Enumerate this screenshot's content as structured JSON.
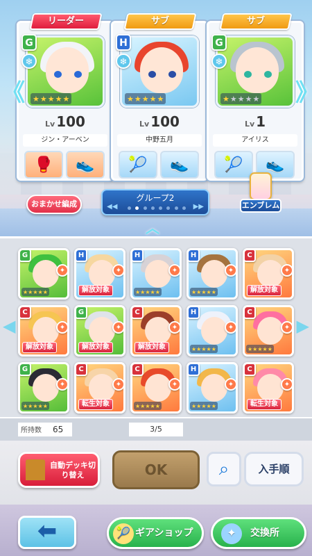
{
  "deck": {
    "slots": [
      {
        "role": "リーダー",
        "role_color": "red",
        "rarity": "G",
        "element": "❄",
        "level_prefix": "Lv",
        "level": "100",
        "name": "ジン・アーベン",
        "hair": "#f2f4f8",
        "eye": "#2a6ad8",
        "gear": [
          "🥊",
          "👟"
        ],
        "stars": 5
      },
      {
        "role": "サブ",
        "role_color": "gold",
        "rarity": "H",
        "element": "❄",
        "level_prefix": "Lv",
        "level": "100",
        "name": "中野五月",
        "hair": "#e8452e",
        "eye": "#2a4ea6",
        "gear": [
          "🎾",
          "👟"
        ],
        "stars": 5
      },
      {
        "role": "サブ",
        "role_color": "gold",
        "rarity": "G",
        "element": "❄",
        "level_prefix": "Lv",
        "level": "1",
        "name": "アイリス",
        "hair": "#b9c4cf",
        "eye": "#2fb6a0",
        "gear": [
          "🎾",
          "👟"
        ],
        "stars": 1
      }
    ]
  },
  "controls": {
    "omakase": "おまかせ編成",
    "group_name": "グループ2",
    "group_prev": "◀◀",
    "group_next": "▶▶",
    "emblem": "エンブレム"
  },
  "roster": {
    "cards": [
      {
        "rarity": "G",
        "type": "g",
        "hair": "#3fc03f",
        "overlay": ""
      },
      {
        "rarity": "H",
        "type": "h",
        "hair": "#f6d7a0",
        "overlay": "解放対象"
      },
      {
        "rarity": "H",
        "type": "h",
        "hair": "#d7d2d6",
        "overlay": ""
      },
      {
        "rarity": "H",
        "type": "h",
        "hair": "#a5733f",
        "overlay": ""
      },
      {
        "rarity": "C",
        "type": "c",
        "hair": "#f3d2a6",
        "overlay": "解放対象"
      },
      {
        "rarity": "C",
        "type": "c",
        "hair": "#f6c552",
        "overlay": "解放対象"
      },
      {
        "rarity": "G",
        "type": "g",
        "hair": "#dfe3ea",
        "overlay": "解放対象"
      },
      {
        "rarity": "C",
        "type": "c",
        "hair": "#9c3f2a",
        "overlay": "解放対象"
      },
      {
        "rarity": "H",
        "type": "h",
        "hair": "#eef2fb",
        "overlay": ""
      },
      {
        "rarity": "C",
        "type": "c",
        "hair": "#ff6fa0",
        "overlay": ""
      },
      {
        "rarity": "G",
        "type": "g",
        "hair": "#2a2a34",
        "overlay": ""
      },
      {
        "rarity": "C",
        "type": "c",
        "hair": "#f7d4a8",
        "overlay": "転生対象"
      },
      {
        "rarity": "C",
        "type": "c",
        "hair": "#e84a2a",
        "overlay": ""
      },
      {
        "rarity": "H",
        "type": "h",
        "hair": "#f2b74a",
        "overlay": ""
      },
      {
        "rarity": "C",
        "type": "c",
        "hair": "#ff8aa8",
        "overlay": "転生対象"
      }
    ]
  },
  "counts": {
    "owned_label": "所持数",
    "owned": "65",
    "page": "3/5"
  },
  "footer": {
    "auto_deck": "自動デッキ切り替え",
    "ok": "OK",
    "sort": "入手順",
    "gear_shop": "ギアショップ",
    "exchange": "交換所"
  }
}
